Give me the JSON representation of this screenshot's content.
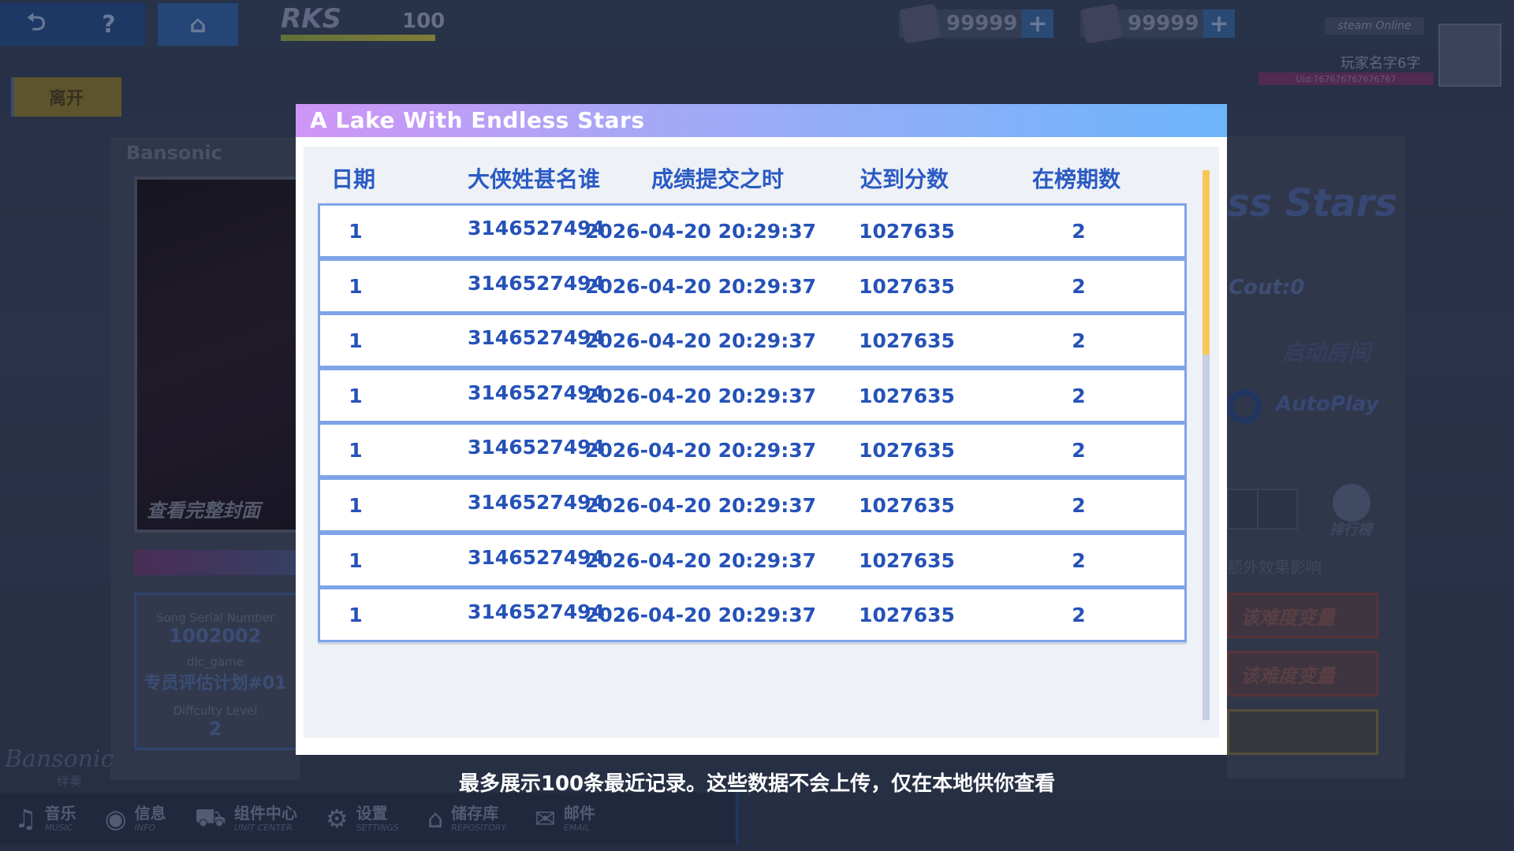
{
  "topbar": {
    "back_icon": "back-arrow-icon",
    "help_label": "?",
    "home_icon": "home-icon",
    "rks_label": "RKS",
    "rks_value": "100",
    "currency1_value": "99999",
    "currency2_value": "99999",
    "plus_label": "+",
    "platform_badge": "steam Online",
    "player_name": "玩家名字6字",
    "uid": "Uid:767676767676767"
  },
  "leave_label": "离开",
  "left_panel": {
    "title": "Bansonic",
    "cover_link": "查看完整封面",
    "serial_label": "Song Serial Number",
    "serial_value": "1002002",
    "game_label": "dlc_game",
    "game_value": "专员评估计划#01",
    "difficulty_label": "Diffculty Level",
    "difficulty_value": "2"
  },
  "right_panel": {
    "title_fragment": "ss Stars",
    "cout": "Cout:0",
    "start_room": "启动房间",
    "autoplay": "AutoPlay",
    "rank_label": "排行榜",
    "note": "额外效果影响",
    "red1": "该难度变量",
    "red2": "该难度变量"
  },
  "bottom_nav": [
    {
      "icon": "music-note-icon",
      "cn": "音乐",
      "en": "MUSIC"
    },
    {
      "icon": "info-icon",
      "cn": "信息",
      "en": "INFO"
    },
    {
      "icon": "cart-icon",
      "cn": "组件中心",
      "en": "UNIT CENTER"
    },
    {
      "icon": "gear-icon",
      "cn": "设置",
      "en": "SETTINGS"
    },
    {
      "icon": "home-icon",
      "cn": "储存库",
      "en": "REPOSITORY"
    },
    {
      "icon": "mail-icon",
      "cn": "邮件",
      "en": "EMAIL"
    }
  ],
  "logo": {
    "text": "Bansonic",
    "sub": "绊奏"
  },
  "modal": {
    "title": "A Lake With Endless Stars",
    "columns": [
      "日期",
      "大侠姓甚名谁",
      "成绩提交之时",
      "达到分数",
      "在榜期数"
    ],
    "rows": [
      [
        "1",
        "3146527494",
        "2026-04-20 20:29:37",
        "1027635",
        "2"
      ],
      [
        "1",
        "3146527494",
        "2026-04-20 20:29:37",
        "1027635",
        "2"
      ],
      [
        "1",
        "3146527494",
        "2026-04-20 20:29:37",
        "1027635",
        "2"
      ],
      [
        "1",
        "3146527494",
        "2026-04-20 20:29:37",
        "1027635",
        "2"
      ],
      [
        "1",
        "3146527494",
        "2026-04-20 20:29:37",
        "1027635",
        "2"
      ],
      [
        "1",
        "3146527494",
        "2026-04-20 20:29:37",
        "1027635",
        "2"
      ],
      [
        "1",
        "3146527494",
        "2026-04-20 20:29:37",
        "1027635",
        "2"
      ],
      [
        "1",
        "3146527494",
        "2026-04-20 20:29:37",
        "1027635",
        "2"
      ]
    ]
  },
  "footer_note": "最多展示100条最近记录。这些数据不会上传，仅在本地供你查看",
  "colors": {
    "header_gradient_start": "#cf95f6",
    "header_gradient_end": "#6db5fb",
    "table_text": "#2552b8",
    "row_border": "#7ea4e8",
    "scroll_thumb": "#f7c85a"
  }
}
